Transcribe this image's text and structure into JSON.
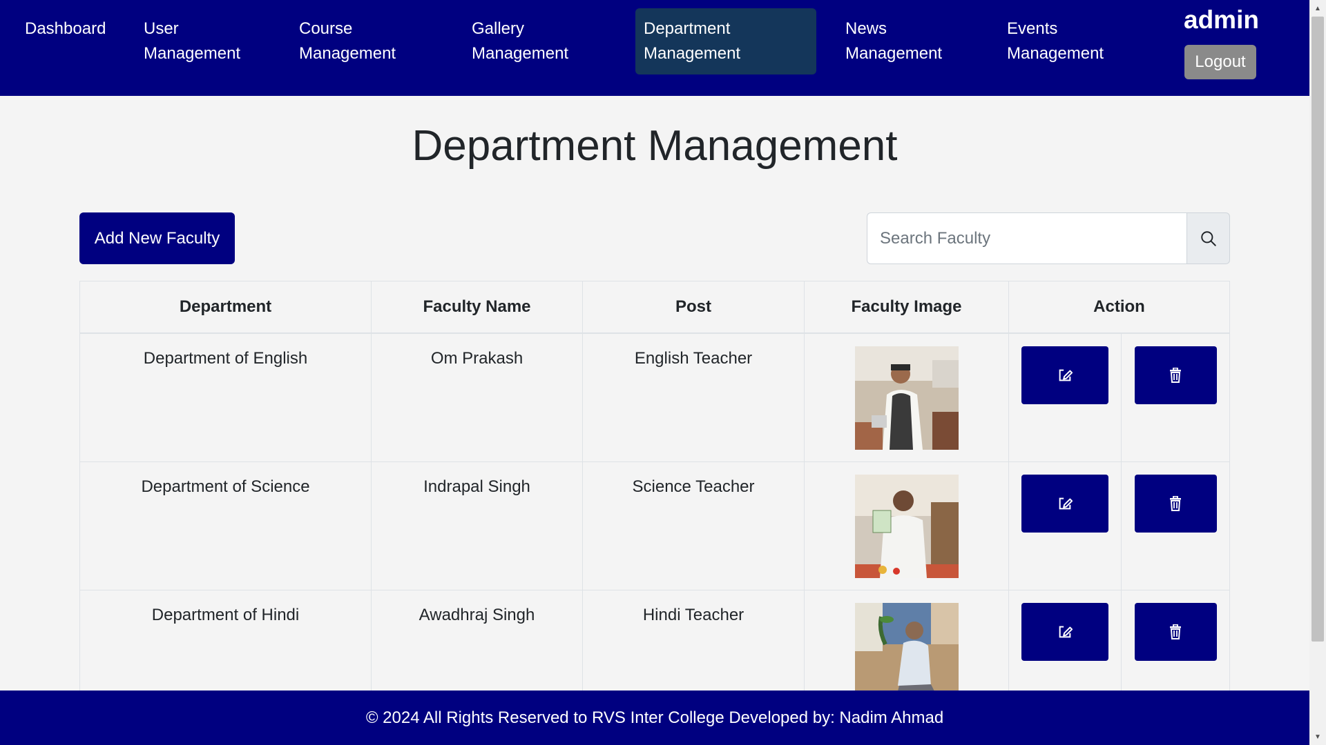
{
  "nav": {
    "items": [
      {
        "line1": "Dashboard",
        "line2": ""
      },
      {
        "line1": "User",
        "line2": "Management"
      },
      {
        "line1": "Course",
        "line2": "Management"
      },
      {
        "line1": "Gallery",
        "line2": "Management"
      },
      {
        "line1": "Department",
        "line2": "Management"
      },
      {
        "line1": "News",
        "line2": "Management"
      },
      {
        "line1": "Events",
        "line2": "Management"
      }
    ],
    "active_index": 4,
    "user": "admin",
    "logout_label": "Logout"
  },
  "page": {
    "title": "Department Management",
    "add_button_label": "Add New Faculty",
    "search_placeholder": "Search Faculty"
  },
  "table": {
    "headers": [
      "Department",
      "Faculty Name",
      "Post",
      "Faculty Image",
      "Action"
    ],
    "rows": [
      {
        "department": "Department of English",
        "faculty_name": "Om Prakash",
        "post": "English Teacher"
      },
      {
        "department": "Department of Science",
        "faculty_name": "Indrapal Singh",
        "post": "Science Teacher"
      },
      {
        "department": "Department of Hindi",
        "faculty_name": "Awadhraj Singh",
        "post": "Hindi Teacher"
      }
    ]
  },
  "icons": {
    "search": "search-icon",
    "edit": "edit-icon",
    "delete": "trash-icon"
  },
  "colors": {
    "primary": "#000080",
    "active_nav": "#14365a",
    "logout": "#8a8a8a"
  },
  "footer": {
    "text": "© 2024 All Rights Reserved to RVS Inter College Developed by: Nadim Ahmad"
  }
}
